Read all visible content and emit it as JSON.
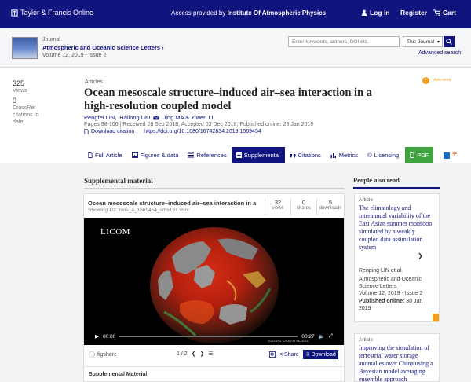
{
  "topbar": {
    "brand": "Taylor & Francis Online",
    "access_prefix": "Access provided by ",
    "access_institution": "Institute Of Atmospheric Physics",
    "login": "Log in",
    "register": "Register",
    "cart": "Cart"
  },
  "journal": {
    "label": "Journal",
    "title": "Atmospheric and Oceanic Science Letters ›",
    "volume": "Volume 12, 2019 - Issue 2",
    "search_placeholder": "Enter keywords, authors, DOI etc.",
    "search_scope": "This Journal",
    "advanced_search": "Advanced search"
  },
  "metrics": {
    "views_count": "325",
    "views_label": "Views",
    "crossref_count": "0",
    "crossref_label_1": "CrossRef",
    "crossref_label_2": "citations to",
    "crossref_label_3": "date"
  },
  "article": {
    "type_label": "Articles",
    "title": "Ocean mesoscale structure–induced air–sea interaction in a high-resolution coupled model",
    "authors": [
      "Pengfei LIN,",
      "Hailong LIU",
      "Jing MA & Yiwen LI"
    ],
    "pages_dates": "Pages 98-106 | Received 28 Sep 2018, Accepted 03 Dec 2018, Published online: 23 Jan 2019",
    "download_citation": "Download citation",
    "doi": "https://doi.org/10.1080/16742834.2019.1569454",
    "altmetric_label": "View more"
  },
  "tabs": [
    {
      "label": "Full Article"
    },
    {
      "label": "Figures & data"
    },
    {
      "label": "References"
    },
    {
      "label": "Supplemental"
    },
    {
      "label": "Citations"
    },
    {
      "label": "Metrics"
    },
    {
      "label": "Licensing"
    },
    {
      "label": "PDF"
    }
  ],
  "supplemental": {
    "heading": "Supplemental material",
    "widget_title": "Ocean mesoscale structure–induced air–sea interaction in a ...",
    "file_line": "Showing 1/2: taos_a_1569454_sm5191.mov",
    "stats": [
      {
        "n": "32",
        "label": "views"
      },
      {
        "n": "0",
        "label": "shares"
      },
      {
        "n": "5",
        "label": "downloads"
      }
    ],
    "video_label": "LICOM",
    "time_current": "00:00",
    "time_total": "00:27",
    "video_progress_fraction": 0.0,
    "credit": "GLOBAL OCEAN MODEL",
    "figshare": "figshare",
    "pager": "1 / 2",
    "share": "Share",
    "download": "Download",
    "footer_label": "Supplemental Material"
  },
  "people_also_read": {
    "heading": "People also read",
    "card1": {
      "type": "Article",
      "title": "The climatology and interannual variability of the East Asian summer monsoon simulated by a weakly coupled data assimilation system",
      "authors": "Renping LIN et al.",
      "journal": "Atmospheric and Oceanic Science Letters",
      "issue": "Volume 12, 2019 - Issue 2",
      "published_label": "Published online:",
      "published_date": "30 Jan 2019"
    },
    "card2": {
      "type": "Article",
      "title": "Improving the simulation of terrestrial water storage anomalies over China using a Bayesian model averaging ensemble approach"
    }
  },
  "colors": {
    "brand_navy": "#10147e",
    "pdf_green": "#3fa33f",
    "accent_orange": "#f49d1a"
  }
}
